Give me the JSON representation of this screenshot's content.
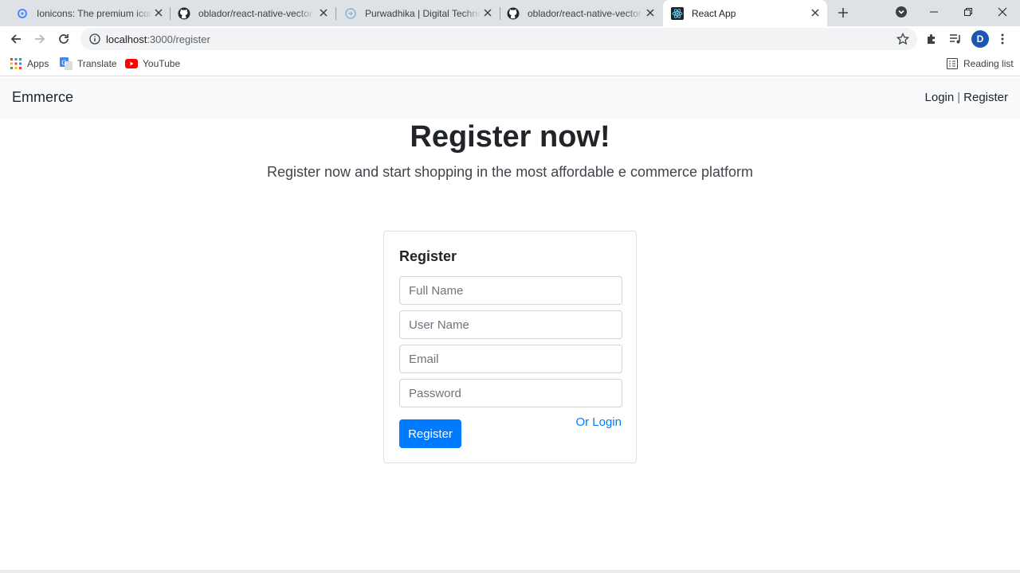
{
  "browser": {
    "tabs": [
      {
        "title": "Ionicons: The premium icon pack",
        "icon": "ionicons-icon"
      },
      {
        "title": "oblador/react-native-vector-icons",
        "icon": "github-icon"
      },
      {
        "title": "Purwadhika | Digital Technology School",
        "icon": "purwadhika-icon"
      },
      {
        "title": "oblador/react-native-vector-icons",
        "icon": "github-icon"
      },
      {
        "title": "React App",
        "icon": "react-icon"
      }
    ],
    "url_host": "localhost",
    "url_path": ":3000/register",
    "profile_initial": "D",
    "bookmarks": [
      {
        "label": "Apps",
        "icon": "apps-grid-icon"
      },
      {
        "label": "Translate",
        "icon": "translate-icon"
      },
      {
        "label": "YouTube",
        "icon": "youtube-icon"
      }
    ],
    "reading_list": "Reading list"
  },
  "navbar": {
    "brand": "Emmerce",
    "login": "Login",
    "separator": "|",
    "register": "Register"
  },
  "hero": {
    "title": "Register now!",
    "subtitle": "Register now and start shopping in the most affordable e commerce platform"
  },
  "form": {
    "title": "Register",
    "fullname_placeholder": "Full Name",
    "username_placeholder": "User Name",
    "email_placeholder": "Email",
    "password_placeholder": "Password",
    "submit_label": "Register",
    "login_link": "Or Login"
  },
  "colors": {
    "primary": "#007bff",
    "navbar_bg": "#f8f9fa",
    "tabstrip_bg": "#dee1e6"
  }
}
